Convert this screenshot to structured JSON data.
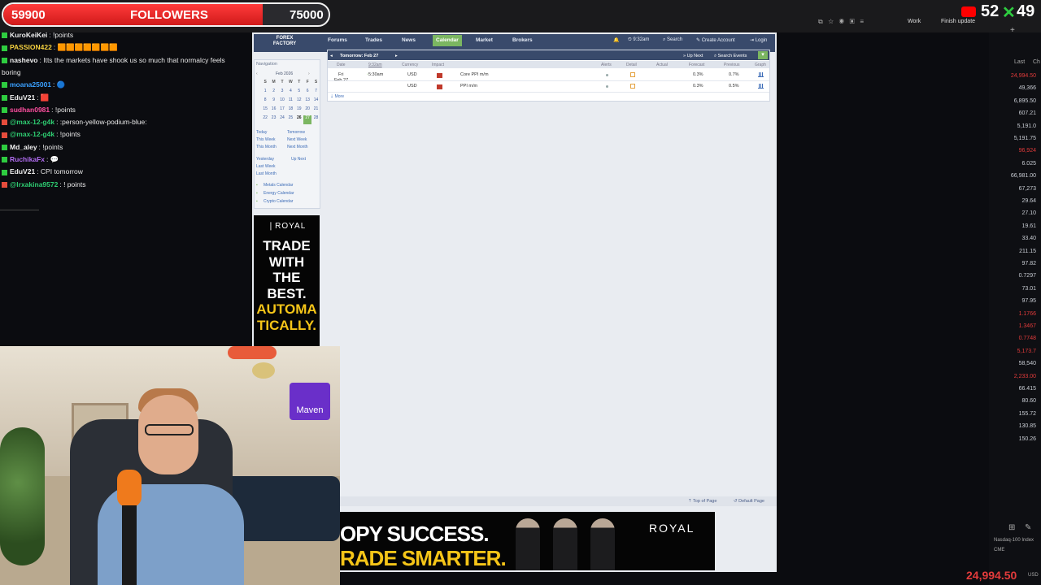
{
  "stream_overlay": {
    "follower_goal": {
      "current": "59900",
      "label": "FOLLOWERS",
      "target": "75000",
      "progress": 0.7987
    },
    "youtube_counter": {
      "left": "52",
      "right": "49"
    }
  },
  "browser_bar": {
    "profile": "Work",
    "update_button": "Finish update"
  },
  "chat": {
    "messages": [
      {
        "user": "KuroKeiKei",
        "text": ": !points",
        "color": "#f0f0f0",
        "badge": "#2ecc40"
      },
      {
        "user": "PASSION422",
        "text": ": 🟧🟧🟧🟧🟧🟧🟧",
        "color": "#f4d03f",
        "badge": "#2ecc40"
      },
      {
        "user": "nashevo",
        "text": ": Itts the markets have shook us so much that normalcy feels",
        "color": "#f0f0f0",
        "badge": "#2ecc40"
      },
      {
        "user": "",
        "text": "boring",
        "color": "#f0f0f0",
        "badge": ""
      },
      {
        "user": "moana25001",
        "text": ": 🔵",
        "color": "#3aa0ff",
        "badge": "#2ecc40"
      },
      {
        "user": "EduV21",
        "text": ": 🟥",
        "color": "#f0f0f0",
        "badge": "#2ecc40"
      },
      {
        "user": "sudhan0981",
        "text": ": !points",
        "color": "#ff4fa0",
        "badge": "#2ecc40"
      },
      {
        "user": "@max-12-g4k",
        "text": ": :person-yellow-podium-blue:",
        "color": "#2ecc71",
        "badge": "#e74c3c"
      },
      {
        "user": "@max-12-g4k",
        "text": ": !points",
        "color": "#2ecc71",
        "badge": "#e74c3c"
      },
      {
        "user": "Md_aley",
        "text": ": !points",
        "color": "#f0f0f0",
        "badge": "#2ecc40"
      },
      {
        "user": "RuchikaFx",
        "text": ": 💬",
        "color": "#b06cf0",
        "badge": "#2ecc40"
      },
      {
        "user": "EduV21",
        "text": ": CPI tomorrow",
        "color": "#f0f0f0",
        "badge": "#2ecc40"
      },
      {
        "user": "@lrxakina9572",
        "text": ": ! points",
        "color": "#2ecc71",
        "badge": "#e74c3c"
      }
    ]
  },
  "site": {
    "logo_line1": "FOREX",
    "logo_line2": "FACTORY",
    "nav": [
      "Forums",
      "Trades",
      "News",
      "Calendar",
      "Market",
      "Brokers"
    ],
    "nav_right": {
      "time": "9:32am",
      "search": "Search",
      "create_account": "Create Account",
      "login": "Login"
    },
    "sidebar": {
      "title": "Navigation",
      "month": "Feb 2026",
      "weekdays": [
        "S",
        "M",
        "T",
        "W",
        "T",
        "F",
        "S"
      ],
      "days": [
        "1",
        "2",
        "3",
        "4",
        "5",
        "6",
        "7",
        "8",
        "9",
        "10",
        "11",
        "12",
        "13",
        "14",
        "15",
        "16",
        "17",
        "18",
        "19",
        "20",
        "21",
        "22",
        "23",
        "24",
        "25",
        "26",
        "27",
        "28"
      ],
      "today": "27",
      "selected": "26",
      "links_a": [
        "Today",
        "This Week",
        "This Month"
      ],
      "links_b": [
        "Tomorrow",
        "Next Week",
        "Next Month"
      ],
      "links_c": [
        "Yesterday",
        "Last Week",
        "Last Month"
      ],
      "up_next": "Up Next",
      "other_calendars": [
        "Metals Calendar",
        "Energy Calendar",
        "Crypto Calendar"
      ]
    },
    "calendar": {
      "tab_title": "Tomorrow: Feb 27",
      "up_next": "Up Next",
      "search_events": "Search Events",
      "columns": [
        "Date",
        "9:32am",
        "Currency",
        "Impact",
        "Alerts",
        "Detail",
        "Actual",
        "Forecast",
        "Previous",
        "Graph"
      ],
      "day": "Fri",
      "date": "Feb 27",
      "rows": [
        {
          "time": "5:30am",
          "currency": "USD",
          "event": "Core PPI m/m",
          "forecast": "0.3%",
          "previous": "0.7%"
        },
        {
          "time": "",
          "currency": "USD",
          "event": "PPI m/m",
          "forecast": "0.3%",
          "previous": "0.5%"
        }
      ],
      "more": "More"
    },
    "footer": {
      "top": "Top of Page",
      "default": "Default Page"
    },
    "ad_side": {
      "brand": "ROYAL",
      "lines": [
        "TRADE",
        "WITH",
        "THE",
        "BEST.",
        "AUTOMA",
        "TICALLY."
      ],
      "line_colors": [
        "#ffffff",
        "#ffffff",
        "#ffffff",
        "#ffffff",
        "#f5c518",
        "#f5c518"
      ]
    },
    "ad_bottom": {
      "line1": "OPY SUCCESS.",
      "line2": "RADE SMARTER.",
      "brand": "ROYAL"
    }
  },
  "ticker": {
    "headers": [
      "Last",
      "Ch"
    ],
    "values": [
      "24,994.50",
      "49,366",
      "6,895.50",
      "607.21",
      "5,191.0",
      "5,191.75",
      "96,924",
      "6.025",
      "66,981.00",
      "67,273",
      "29.64",
      "27.10",
      "19.61",
      "33.40",
      "211.15",
      "97.82",
      "0.7297",
      "73.01",
      "97.95",
      "1.1766",
      "1.3467",
      "0.7748",
      "5,173.7",
      "58,540",
      "2,233.00",
      "66.415",
      "80.60",
      "155.72",
      "130.85",
      "150.26"
    ],
    "colors": [
      "#e23b3b",
      "#c9cdd4",
      "#c9cdd4",
      "#c9cdd4",
      "#c9cdd4",
      "#c9cdd4",
      "#e23b3b",
      "#c9cdd4",
      "#c9cdd4",
      "#c9cdd4",
      "#c9cdd4",
      "#c9cdd4",
      "#c9cdd4",
      "#c9cdd4",
      "#c9cdd4",
      "#c9cdd4",
      "#c9cdd4",
      "#c9cdd4",
      "#c9cdd4",
      "#e23b3b",
      "#e23b3b",
      "#e23b3b",
      "#e23b3b",
      "#c9cdd4",
      "#e23b3b",
      "#c9cdd4",
      "#c9cdd4",
      "#c9cdd4",
      "#c9cdd4",
      "#c9cdd4"
    ],
    "bottom_label": "Nasdaq-100 Index",
    "bottom_exchange": "CME",
    "bottom_price": "24,994.50",
    "bottom_unit": "USD"
  },
  "webcam": {
    "logo": "Maven"
  }
}
